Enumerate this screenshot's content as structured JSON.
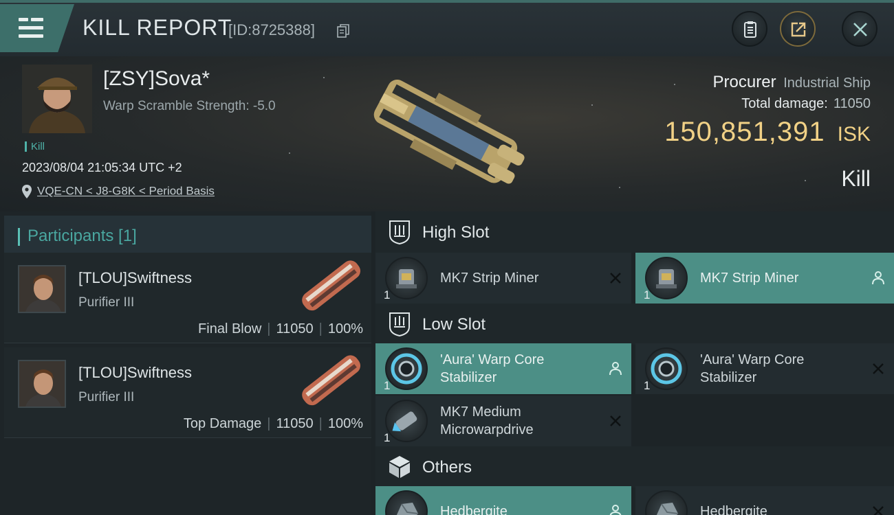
{
  "header": {
    "title": "KILL REPORT",
    "report_id": "[ID:8725388]"
  },
  "victim": {
    "name": "[ZSY]Sova*",
    "warp_scramble": "Warp Scramble Strength: -5.0",
    "kill_tag": "Kill",
    "timestamp": "2023/08/04 21:05:34 UTC +2",
    "location": "VQE-CN < J8-G8K < Period Basis"
  },
  "ship": {
    "name": "Procurer",
    "class": "Industrial Ship",
    "total_damage_label": "Total damage:",
    "total_damage": "11050",
    "isk_value": "150,851,391",
    "isk_unit": "ISK",
    "result": "Kill"
  },
  "participants": {
    "header": "Participants [1]",
    "items": [
      {
        "name": "[TLOU]Swiftness",
        "ship": "Purifier III",
        "role": "Final Blow",
        "damage": "11050",
        "percent": "100%"
      },
      {
        "name": "[TLOU]Swiftness",
        "ship": "Purifier III",
        "role": "Top Damage",
        "damage": "11050",
        "percent": "100%"
      }
    ]
  },
  "slots": {
    "high": {
      "label": "High Slot",
      "items": [
        {
          "name": "MK7 Strip Miner",
          "qty": "1",
          "status": "destroyed"
        },
        {
          "name": "MK7 Strip Miner",
          "qty": "1",
          "status": "dropped"
        }
      ]
    },
    "low": {
      "label": "Low Slot",
      "items": [
        {
          "name_line1": "'Aura' Warp Core",
          "name_line2": "Stabilizer",
          "qty": "1",
          "status": "dropped"
        },
        {
          "name_line1": "'Aura' Warp Core",
          "name_line2": "Stabilizer",
          "qty": "1",
          "status": "destroyed"
        },
        {
          "name_line1": "MK7 Medium",
          "name_line2": "Microwarpdrive",
          "qty": "1",
          "status": "destroyed"
        }
      ]
    },
    "others": {
      "label": "Others",
      "items": [
        {
          "name": "Hedbergite",
          "status": "dropped"
        },
        {
          "name": "Hedbergite",
          "status": "destroyed"
        }
      ]
    }
  },
  "colors": {
    "accent": "#4c8f86",
    "isk": "#f1d186",
    "kill_tag": "#4fb3a9"
  }
}
